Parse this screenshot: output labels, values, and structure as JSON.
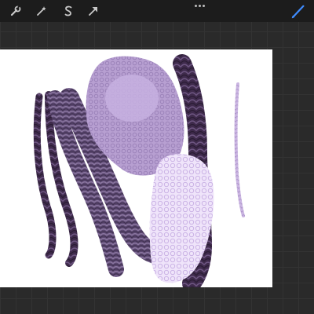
{
  "toolbar": {
    "tools": [
      {
        "icon": "wrench-icon",
        "name": "actions"
      },
      {
        "icon": "magic-wand-icon",
        "name": "adjustments"
      },
      {
        "icon": "selection-s-icon",
        "name": "selection"
      },
      {
        "icon": "move-arrow-icon",
        "name": "transform"
      }
    ],
    "more_icon": "ellipsis-icon",
    "active_tool": {
      "icon": "paintbrush-icon",
      "name": "brush"
    }
  },
  "colors": {
    "accent": "#3f8cff",
    "toolbar_bg": "#1c1c1c",
    "workspace_bg": "#2a2a2a",
    "canvas_bg": "#ffffff",
    "dark_purple": "#3f2b4c",
    "medium_purple": "#5c4871",
    "light_purple": "#b79fd1",
    "pale_purple": "#efe4fa"
  },
  "canvas": {
    "strokes": [
      {
        "name": "dark-braid-stroke",
        "color": "dark_purple"
      },
      {
        "name": "thin-braid-stroke",
        "color": "dark_purple"
      },
      {
        "name": "ringlet-stroke",
        "color": "medium_purple"
      },
      {
        "name": "fluffy-curl-stroke",
        "color": "light_purple"
      },
      {
        "name": "pale-curl-stroke",
        "color": "pale_purple"
      },
      {
        "name": "small-braid-stroke",
        "color": "light_purple"
      }
    ]
  }
}
